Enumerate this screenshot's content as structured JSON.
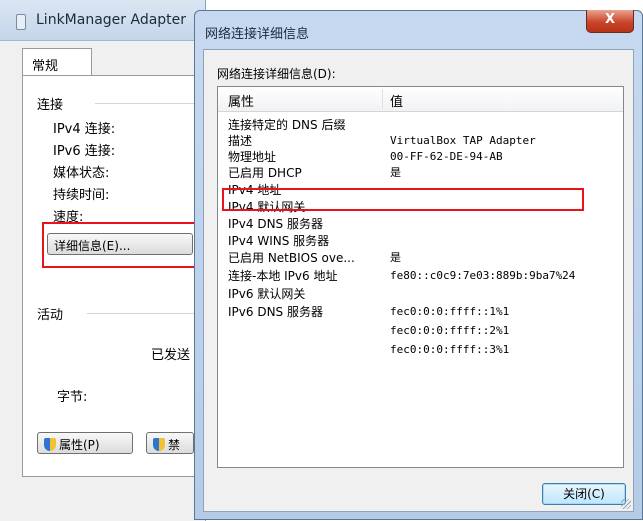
{
  "background_window": {
    "title": "LinkManager Adapter",
    "tab_general": "常规",
    "section_connection": "连接",
    "ipv4_connectivity": "IPv4 连接:",
    "ipv6_connectivity": "IPv6 连接:",
    "media_state": "媒体状态:",
    "duration": "持续时间:",
    "speed": "速度:",
    "details_button": "详细信息(E)...",
    "section_activity": "活动",
    "sent_label": "已发送",
    "bytes_label": "字节:",
    "properties_button": "属性(P)",
    "disable_button": "禁"
  },
  "dialog": {
    "title": "网络连接详细信息",
    "close_label": "X",
    "caption": "网络连接详细信息(D):",
    "columns": {
      "property": "属性",
      "value": "值"
    },
    "rows": [
      {
        "property": "连接特定的 DNS 后缀",
        "value": ""
      },
      {
        "property": "描述",
        "value": "VirtualBox TAP Adapter"
      },
      {
        "property": "物理地址",
        "value": "00-FF-62-DE-94-AB"
      },
      {
        "property": "已启用 DHCP",
        "value": "是"
      },
      {
        "property": "IPv4 地址",
        "value": ""
      },
      {
        "property": "IPv4 默认网关",
        "value": ""
      },
      {
        "property": "IPv4 DNS 服务器",
        "value": ""
      },
      {
        "property": "IPv4 WINS 服务器",
        "value": ""
      },
      {
        "property": "已启用 NetBIOS ove...",
        "value": "是"
      },
      {
        "property": "连接-本地 IPv6 地址",
        "value": "fe80::c0c9:7e03:889b:9ba7%24"
      },
      {
        "property": "IPv6 默认网关",
        "value": ""
      },
      {
        "property": "IPv6 DNS 服务器",
        "value": "fec0:0:0:ffff::1%1"
      },
      {
        "property": "",
        "value": "fec0:0:0:ffff::2%1"
      },
      {
        "property": "",
        "value": "fec0:0:0:ffff::3%1"
      }
    ],
    "close_button": "关闭(C)"
  },
  "colors": {
    "highlight_box": "#e8141b",
    "title_bar": "#c6d9f0",
    "close_button": "#c9452b"
  }
}
